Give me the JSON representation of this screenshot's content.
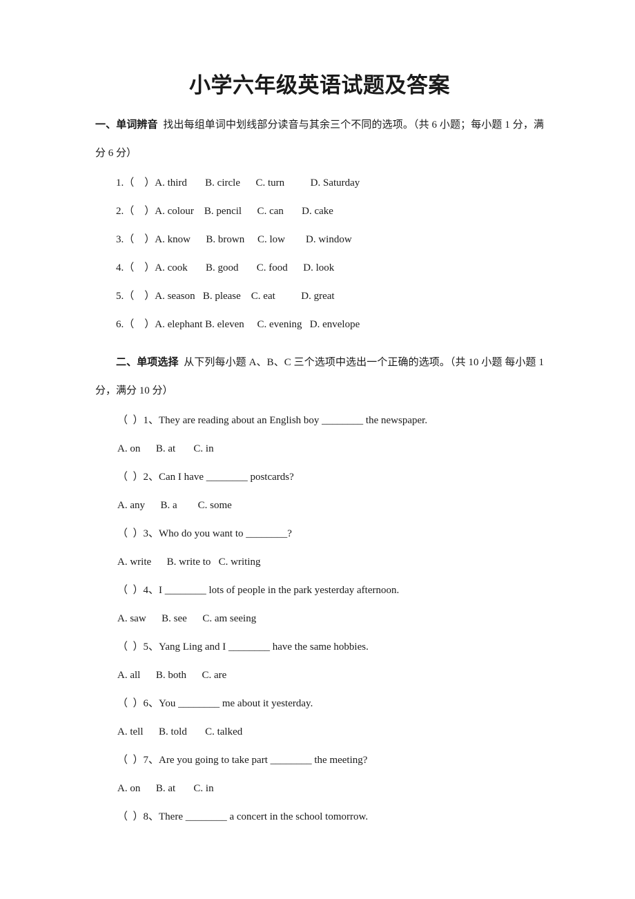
{
  "document": {
    "title": "小学六年级英语试题及答案"
  },
  "sections": [
    {
      "number_label": "一、",
      "name": "单词辨音",
      "instruction": "找出每组单词中划线部分读音与其余三个不同的选项。（共 6 小题；每小题 1 分，满分 6 分）",
      "items": [
        {
          "text": "1.（    ）A. third       B. circle      C. turn          D. Saturday"
        },
        {
          "text": "2.（    ）A. colour    B. pencil      C. can       D. cake"
        },
        {
          "text": "3.（    ）A. know      B. brown     C. low        D. window"
        },
        {
          "text": "4.（    ）A. cook       B. good       C. food      D. look"
        },
        {
          "text": "5.（    ）A. season   B. please    C. eat          D. great"
        },
        {
          "text": "6.（    ）A. elephant B. eleven     C. evening   D. envelope"
        }
      ]
    },
    {
      "number_label": "二、",
      "name": "单项选择",
      "instruction": "从下列每小题 A、B、C 三个选项中选出一个正确的选项。（共 10 小题 每小题 1 分，满分 10 分）",
      "questions": [
        {
          "stem": "（  ）1、They are reading about an English boy ________ the newspaper.",
          "options": "A. on      B. at       C. in"
        },
        {
          "stem": "（  ）2、Can I have ________ postcards?",
          "options": "A. any      B. a        C. some"
        },
        {
          "stem": "（  ）3、Who do you want to ________?",
          "options": "A. write      B. write to   C. writing"
        },
        {
          "stem": "（  ）4、I ________ lots of people in the park yesterday afternoon.",
          "options": "A. saw      B. see      C. am seeing"
        },
        {
          "stem": "（  ）5、Yang Ling and I ________ have the same hobbies.",
          "options": "A. all      B. both      C. are"
        },
        {
          "stem": "（  ）6、You ________ me about it yesterday.",
          "options": "A. tell      B. told       C. talked"
        },
        {
          "stem": "（  ）7、Are you going to take part ________ the meeting?",
          "options": "A. on      B. at       C. in"
        },
        {
          "stem": "（  ）8、There ________ a concert in the school tomorrow.",
          "options": ""
        }
      ]
    }
  ]
}
